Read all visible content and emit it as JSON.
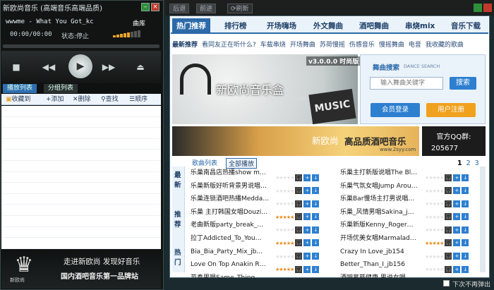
{
  "player": {
    "title": "新欧尚音乐 (高端音乐高端品质)",
    "song": "wwwme - What You Got_kc",
    "time": "00:00/00:00",
    "status": "状态:停止",
    "library": "曲库",
    "tabs": [
      "播放列表",
      "分组列表"
    ],
    "toolbar": [
      "收藏到",
      "+添加",
      "✕删除",
      "查找",
      "顺序"
    ],
    "slogan1": "走进新欧尚 发现好音乐",
    "slogan2": "国内酒吧音乐第一品牌站",
    "logo_text": "新欧尚"
  },
  "web": {
    "nav": [
      "后退",
      "前进",
      "刷新"
    ],
    "main_tabs": [
      "热门推荐",
      "排行榜",
      "开场嗨场",
      "外文舞曲",
      "酒吧舞曲",
      "串烧mix",
      "音乐下载"
    ],
    "sub_nav": [
      "最新推荐",
      "看同友正在听什么?",
      "车载串烧",
      "开场舞曲",
      "苏荷慢摇",
      "伤感音乐",
      "慢摇舞曲",
      "电音",
      "我收藏的歌曲"
    ],
    "hero": {
      "version": "v3.0.0.0 时尚版",
      "title": "新欧尚音乐盒",
      "url": "WWW.2SYY.COM",
      "music": "MUSIC"
    },
    "search": {
      "title": "舞曲搜索",
      "sub": "DANCE SEARCH",
      "placeholder": "输入舞曲关键字",
      "button": "搜索",
      "login": "会员登录",
      "register": "用户注册"
    },
    "ad": {
      "brand": "新欧尚",
      "text": "高品质酒吧音乐",
      "url": "www.2syy.com"
    },
    "qq": {
      "label": "官方QQ群:",
      "number": "205677"
    },
    "list_tabs": [
      "歌曲列表",
      "全部播放"
    ],
    "pages": [
      "1",
      "2",
      "3"
    ],
    "side": [
      "最",
      "新",
      "推",
      "荐",
      "热",
      "门"
    ],
    "left_songs": [
      {
        "t": "乐巢南昌店热播show m…",
        "hot": false
      },
      {
        "t": "乐巢新版好听背景男说唱…",
        "hot": false
      },
      {
        "t": "乐巢连锁酒吧热播Medda…",
        "hot": false
      },
      {
        "t": "乐巢 主打韩国女唱Douzi…",
        "hot": true
      },
      {
        "t": "老曲新版party_break_…",
        "hot": false
      },
      {
        "t": "拉丁Addicted_To_You…",
        "hot": true
      },
      {
        "t": "Bia_Bia_Party_Mix_jb…",
        "hot": false
      },
      {
        "t": "Love On Top Anakin R…",
        "hot": true
      },
      {
        "t": "节奏男唱Same_Thing_…",
        "hot": false
      }
    ],
    "right_songs": [
      {
        "t": "乐巢主打新版说唱The Bl…",
        "hot": false
      },
      {
        "t": "乐巢气氛女唱Jump Arou…",
        "hot": false
      },
      {
        "t": "乐巢Bar慢场主打男说唱…",
        "hot": false
      },
      {
        "t": "乐巢_风情男唱Sakina_j…",
        "hot": false
      },
      {
        "t": "乐巢新版Kenny_Roger…",
        "hot": false
      },
      {
        "t": "开场优美女唱Marmalad…",
        "hot": true
      },
      {
        "t": "Crazy In Love_jb154",
        "hot": false
      },
      {
        "t": "Better_Than_I_jb156",
        "hot": false
      },
      {
        "t": "酒吧慕慈健康 男说女唱…",
        "hot": false
      }
    ],
    "footer": "下次不再弹出"
  }
}
